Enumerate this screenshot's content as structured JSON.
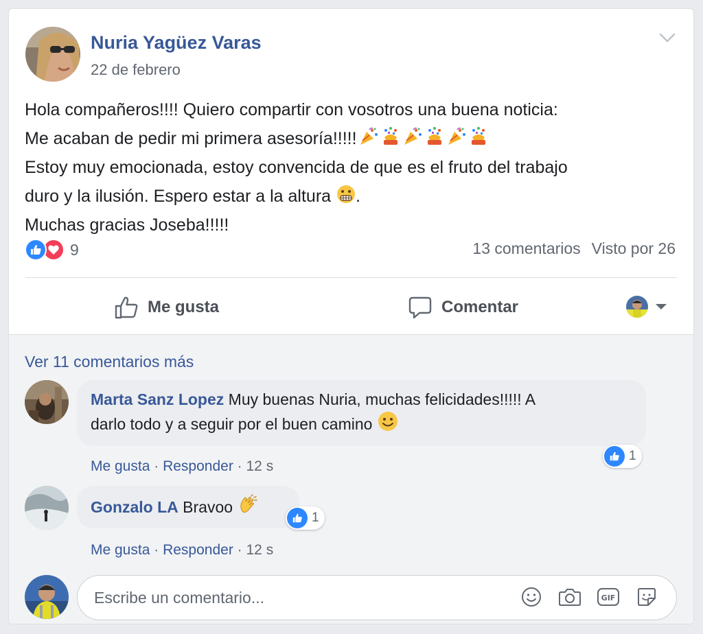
{
  "post": {
    "author": "Nuria Yagüez Varas",
    "date": "22 de febrero",
    "body": {
      "line1": "Hola compañeros!!!! Quiero compartir con vosotros una buena noticia:",
      "line2": "Me acaban de pedir mi primera asesoría!!!!!",
      "line3": "Estoy muy emocionada, estoy convencida de que es el fruto del trabajo",
      "line4": "duro y la ilusión. Espero estar a la altura",
      "line4_end": ".",
      "line5": "Muchas gracias Joseba!!!!!"
    },
    "emojis": {
      "celebration": [
        "party-popper-icon",
        "confetti-icon",
        "party-popper-icon",
        "confetti-icon",
        "party-popper-icon",
        "confetti-icon"
      ],
      "face": "grimacing-face-icon"
    },
    "reactions": {
      "types": [
        "like-reaction-icon",
        "love-reaction-icon"
      ],
      "count": "9"
    },
    "comments_count": "13 comentarios",
    "views": "Visto por 26"
  },
  "actions": {
    "like": "Me gusta",
    "comment": "Comentar"
  },
  "comments": {
    "more_link": "Ver 11 comentarios más",
    "items": [
      {
        "name": "Marta Sanz Lopez",
        "text": "Muy buenas Nuria, muchas felicidades!!!!! A",
        "text2": "darlo todo y a seguir por el buen camino",
        "emoji": "smiling-face-icon",
        "reaction_count": "1",
        "like": "Me gusta",
        "reply": "Responder",
        "time": "12 s",
        "sep": "·"
      },
      {
        "name": "Gonzalo LA",
        "text": "Bravoo",
        "emoji": "clapping-hands-icon",
        "reaction_count": "1",
        "like": "Me gusta",
        "reply": "Responder",
        "time": "12 s",
        "sep": "·"
      }
    ]
  },
  "composer": {
    "placeholder": "Escribe un comentario...",
    "icons": [
      "emoji-icon",
      "camera-icon",
      "gif-icon",
      "sticker-icon"
    ]
  },
  "colors": {
    "link": "#385898",
    "like_blue": "#2d88ff",
    "love_red": "#f33e58",
    "muted": "#616770",
    "background": "#e9ebee"
  }
}
